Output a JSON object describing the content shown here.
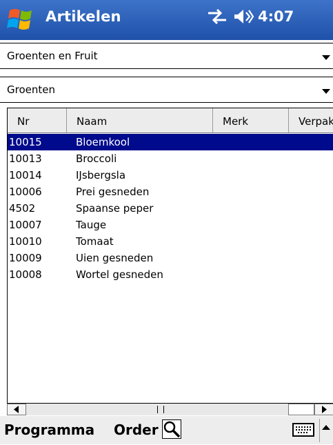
{
  "title": "Artikelen",
  "status": {
    "time": "4:07"
  },
  "category_combo": {
    "value": "Groenten en Fruit"
  },
  "subcategory_combo": {
    "value": "Groenten"
  },
  "columns": [
    "Nr",
    "Naam",
    "Merk",
    "Verpak"
  ],
  "rows": [
    {
      "nr": "10015",
      "naam": "Bloemkool",
      "selected": true
    },
    {
      "nr": "10013",
      "naam": "Broccoli"
    },
    {
      "nr": "10014",
      "naam": "IJsbergsla"
    },
    {
      "nr": "10006",
      "naam": "Prei gesneden"
    },
    {
      "nr": "4502",
      "naam": "Spaanse peper"
    },
    {
      "nr": "10007",
      "naam": "Tauge"
    },
    {
      "nr": "10010",
      "naam": "Tomaat"
    },
    {
      "nr": "10009",
      "naam": "Uien gesneden"
    },
    {
      "nr": "10008",
      "naam": "Wortel gesneden"
    }
  ],
  "menu": {
    "programma": "Programma",
    "order": "Order"
  },
  "icons": {
    "start": "windows-flag-icon",
    "connectivity": "connectivity-arrows-icon",
    "volume": "speaker-icon",
    "search": "magnifier-icon",
    "keyboard": "keyboard-icon",
    "sip": "sip-arrow-icon"
  },
  "colors": {
    "titlebar": "#2a5fbd",
    "selection": "#000a8c",
    "menubar": "#ededed"
  }
}
